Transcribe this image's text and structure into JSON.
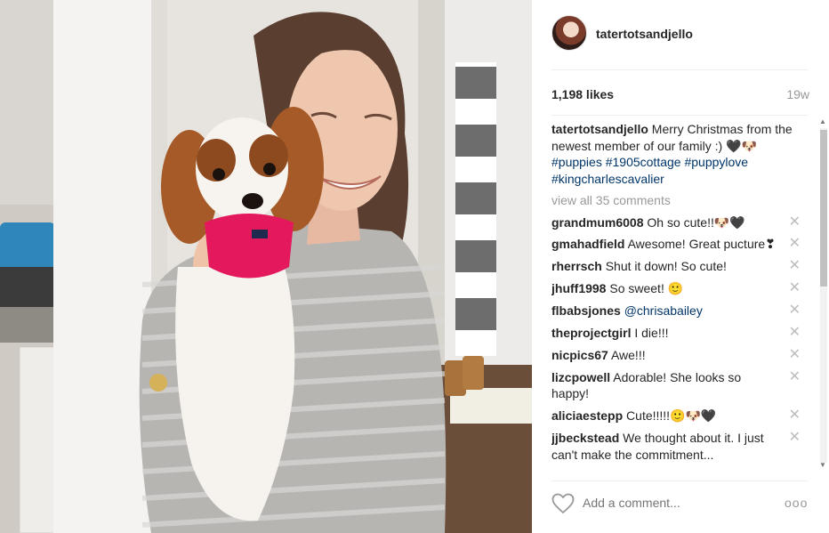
{
  "post": {
    "username": "tatertotsandjello",
    "likes": "1,198 likes",
    "age": "19w"
  },
  "caption": {
    "username": "tatertotsandjello",
    "text": " Merry Christmas from the newest member of our family :) 🖤🐶",
    "tags": [
      "#puppies",
      "#1905cottage",
      "#puppylove",
      "#kingcharlescavalier"
    ]
  },
  "view_all": "view all 35 comments",
  "comments": [
    {
      "user": "grandmum6008",
      "text": " Oh so cute!!🐶🖤"
    },
    {
      "user": "gmahadfield",
      "text": " Awesome! Great pucture❣"
    },
    {
      "user": "rherrsch",
      "text": " Shut it down! So cute!"
    },
    {
      "user": "jhuff1998",
      "text": " So sweet! 🙂"
    },
    {
      "user": "flbabsjones",
      "mention": "@chrisabailey",
      "text": ""
    },
    {
      "user": "theprojectgirl",
      "text": " I die!!!"
    },
    {
      "user": "nicpics67",
      "text": " Awe!!!"
    },
    {
      "user": "lizcpowell",
      "text": " Adorable! She looks so happy!"
    },
    {
      "user": "aliciaestepp",
      "text": " Cute!!!!!🙂🐶🖤"
    },
    {
      "user": "jjbeckstead",
      "text": " We thought about it. I just can't make the commitment..."
    }
  ],
  "delete_glyph": "✕",
  "bottom_bar": {
    "add_comment_placeholder": "Add a comment...",
    "more_glyph": "ooo"
  },
  "scrollbar": {
    "up": "▲",
    "down": "▼"
  },
  "icons": {
    "heart": "heart-outline-icon",
    "close": "close-icon",
    "more": "more-options-icon"
  }
}
